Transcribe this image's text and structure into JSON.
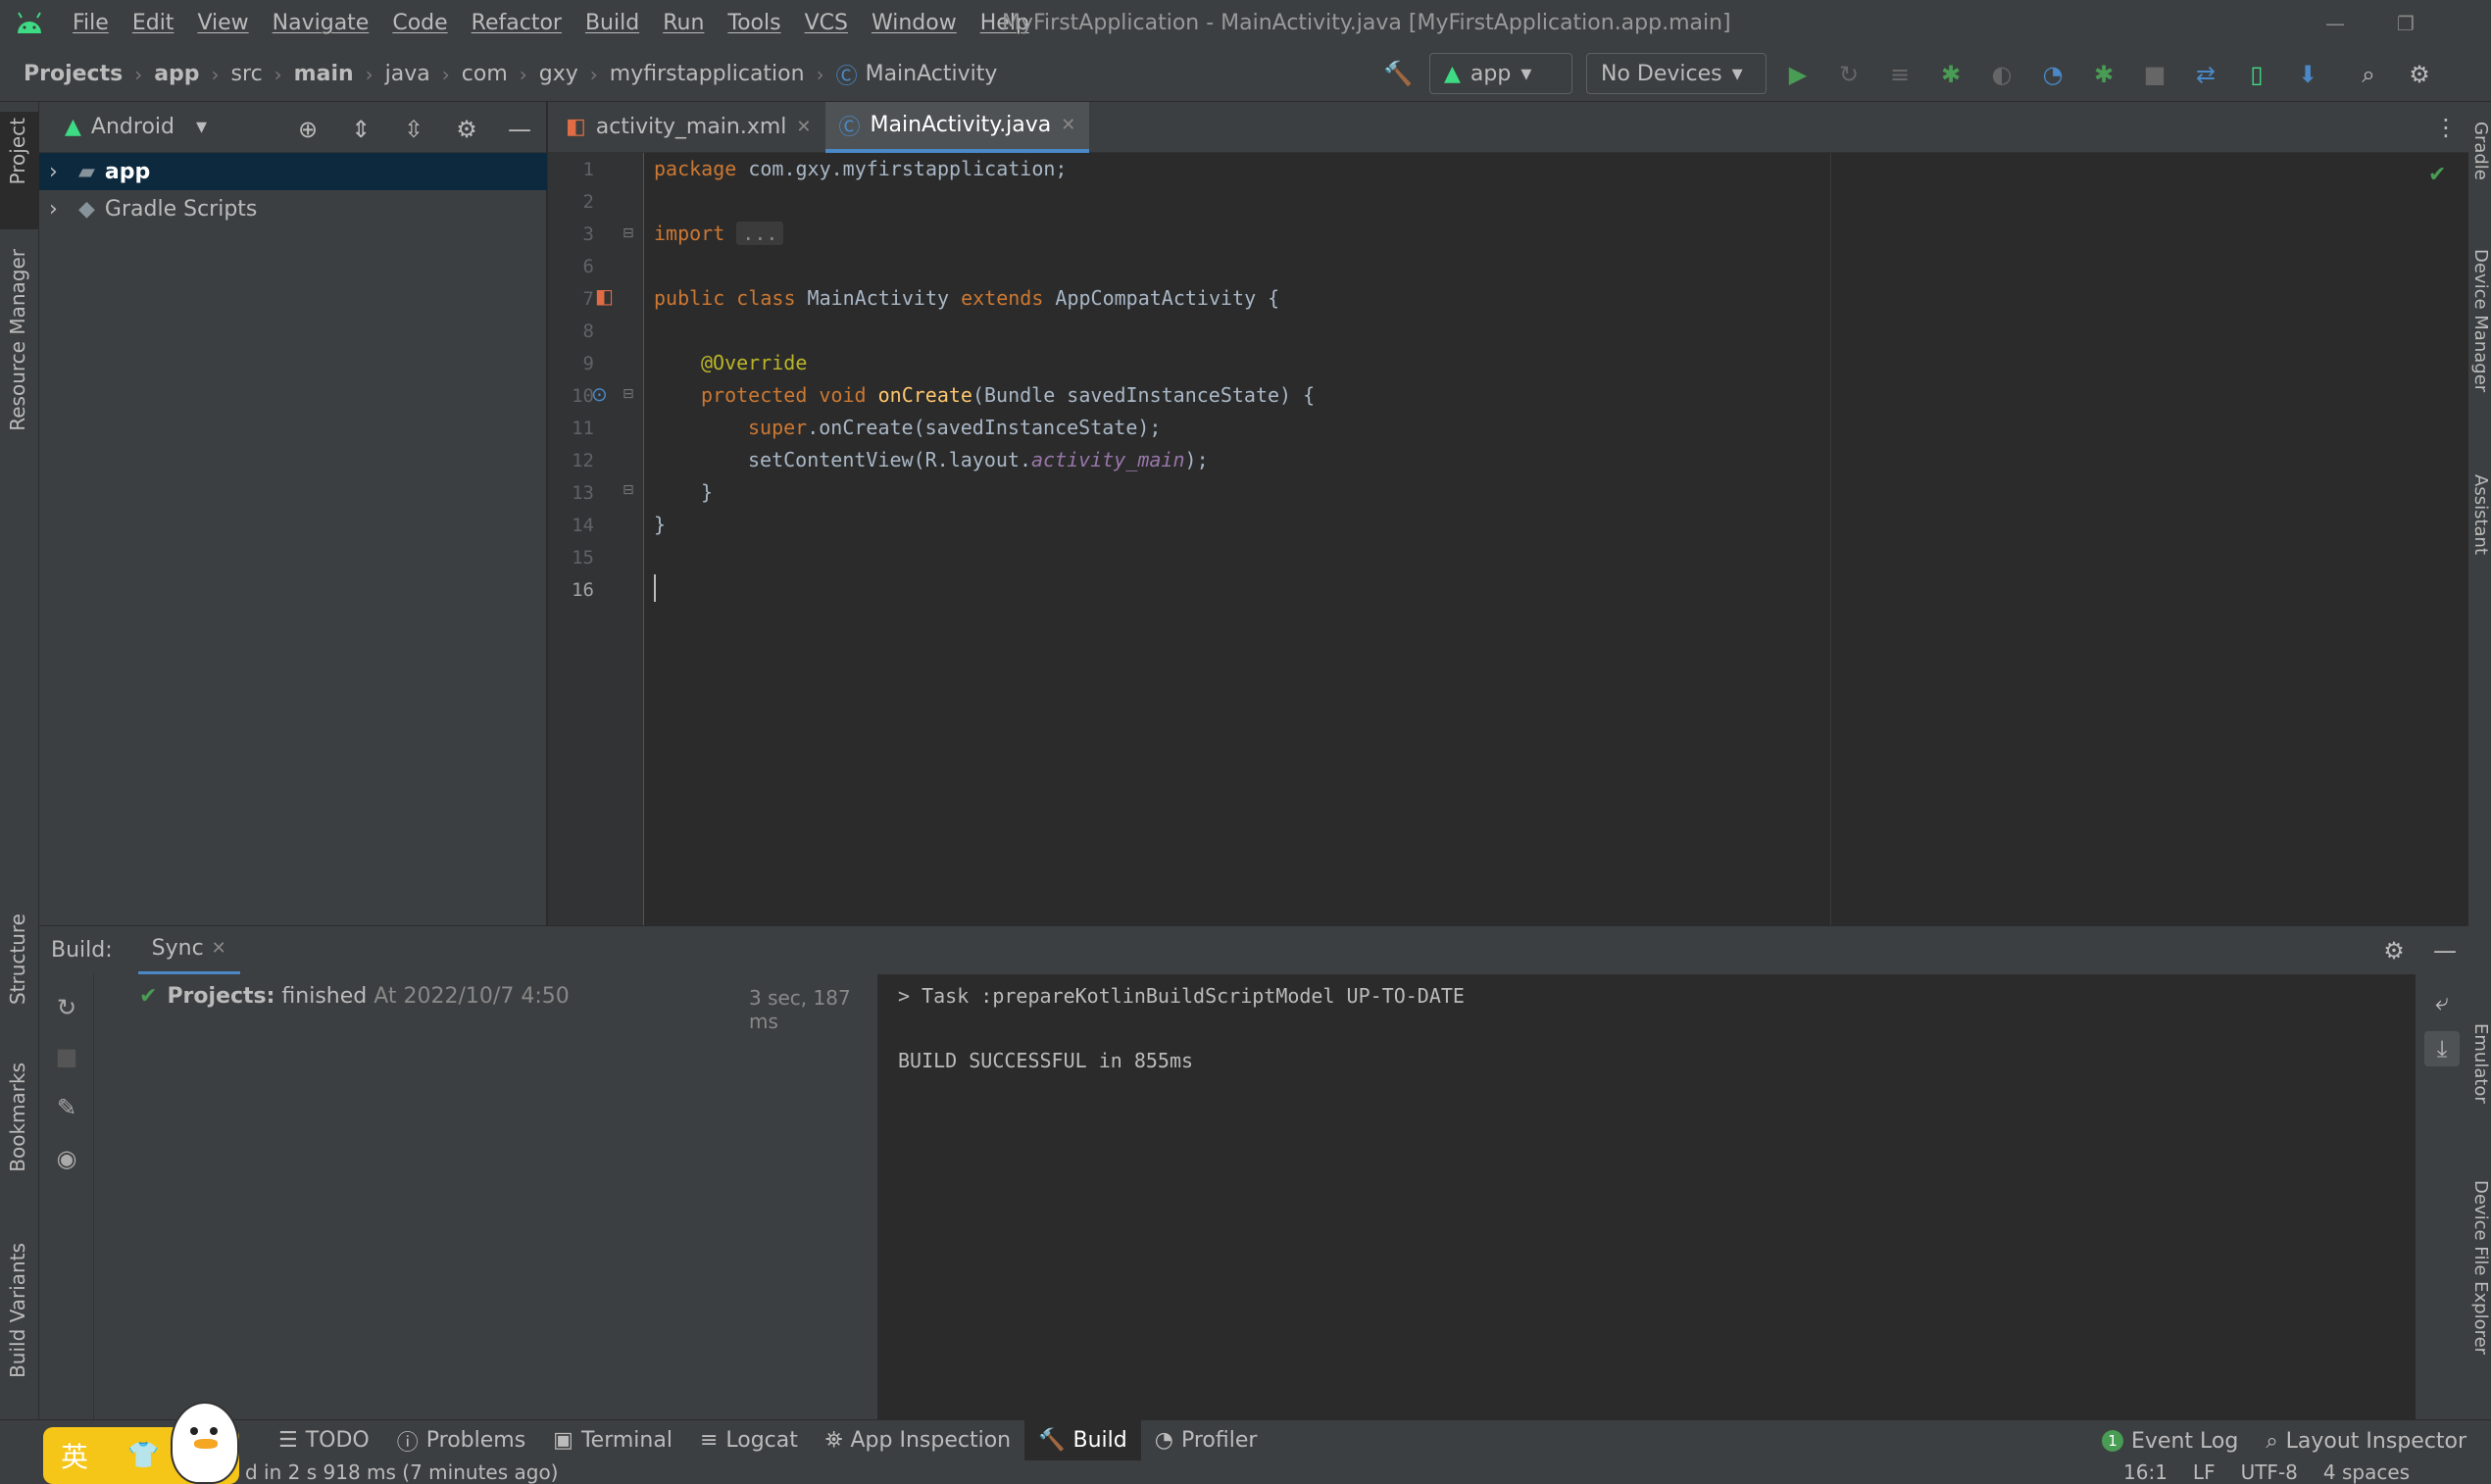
{
  "menu": [
    "File",
    "Edit",
    "View",
    "Navigate",
    "Code",
    "Refactor",
    "Build",
    "Run",
    "Tools",
    "VCS",
    "Window",
    "Help"
  ],
  "window_title": "MyFirstApplication - MainActivity.java [MyFirstApplication.app.main]",
  "breadcrumb": [
    "Projects",
    "app",
    "src",
    "main",
    "java",
    "com",
    "gxy",
    "myfirstapplication",
    "MainActivity"
  ],
  "run_config": "app",
  "device": "No Devices",
  "project_panel": {
    "view": "Android",
    "items": [
      {
        "label": "app",
        "selected": true
      },
      {
        "label": "Gradle Scripts",
        "selected": false
      }
    ]
  },
  "left_stripe": [
    "Project",
    "Resource Manager",
    "Structure",
    "Bookmarks",
    "Build Variants"
  ],
  "right_stripe": [
    "Gradle",
    "Device Manager",
    "Assistant",
    "Emulator",
    "Device File Explorer"
  ],
  "editor_tabs": [
    {
      "label": "activity_main.xml",
      "active": false
    },
    {
      "label": "MainActivity.java",
      "active": true
    }
  ],
  "code": {
    "line_numbers": [
      "1",
      "2",
      "3",
      "6",
      "7",
      "8",
      "9",
      "10",
      "11",
      "12",
      "13",
      "14",
      "15",
      "16"
    ],
    "package_kw": "package",
    "package_name": " com.gxy.myfirstapplication;",
    "import_kw": "import",
    "import_fold": "...",
    "class_line": {
      "kw1": "public",
      "kw2": "class",
      "name": " MainActivity ",
      "kw3": "extends",
      "rest": " AppCompatActivity {"
    },
    "annotation": "@Override",
    "method_line": {
      "kw1": "protected",
      "kw2": "void",
      "fn": "onCreate",
      "rest": "(Bundle savedInstanceState) {"
    },
    "super_line": {
      "kw": "super",
      "rest": ".onCreate(savedInstanceState);"
    },
    "set_line": {
      "pre": "setContentView(R.layout.",
      "it": "activity_main",
      "post": ");"
    },
    "close1": "}",
    "close2": "}"
  },
  "build": {
    "label": "Build:",
    "tab": "Sync",
    "tree_title": "Projects:",
    "tree_status": " finished",
    "tree_time": " At 2022/10/7 4:50",
    "duration": "3 sec, 187 ms",
    "console": [
      "> Task :prepareKotlinBuildScriptModel UP-TO-DATE",
      "",
      "BUILD SUCCESSFUL in 855ms"
    ]
  },
  "tools": [
    "TODO",
    "Problems",
    "Terminal",
    "Logcat",
    "App Inspection",
    "Build",
    "Profiler"
  ],
  "tools_right": [
    "Event Log",
    "Layout Inspector"
  ],
  "event_count": "1",
  "status": {
    "message": "d in 2 s 918 ms (7 minutes ago)",
    "position": "16:1",
    "line_sep": "LF",
    "encoding": "UTF-8",
    "indent": "4 spaces"
  },
  "ime": {
    "label": "英"
  },
  "colors": {
    "accent": "#4a88c7",
    "green": "#499c54",
    "keyword": "#cc7832"
  }
}
